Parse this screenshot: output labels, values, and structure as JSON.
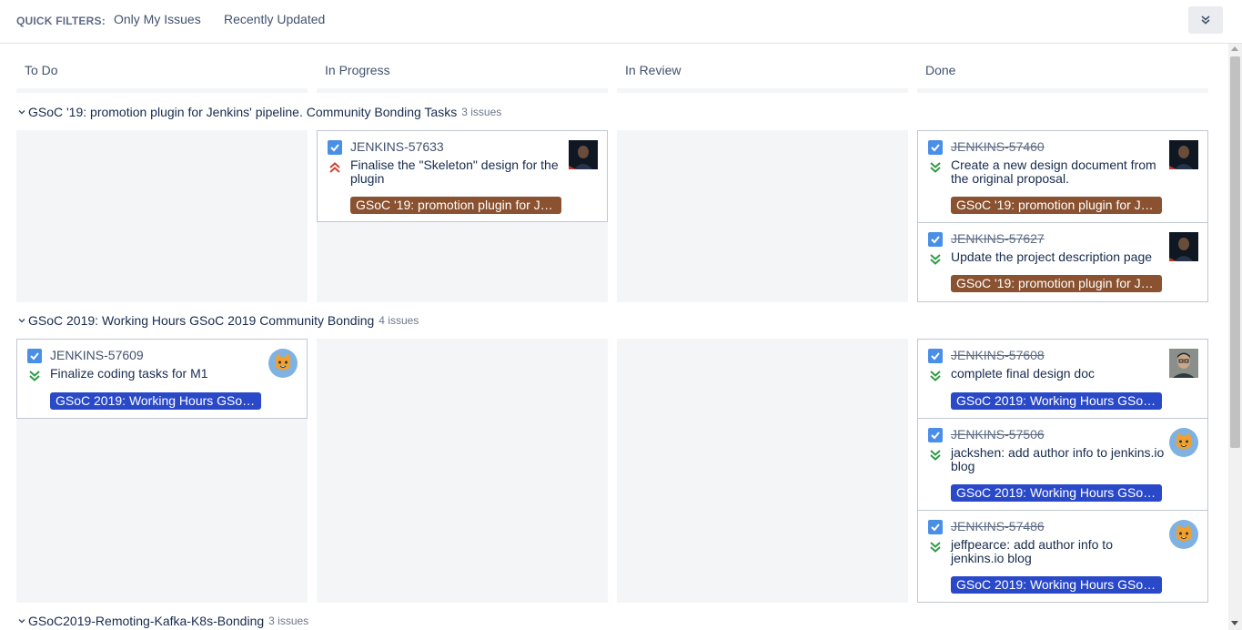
{
  "quick_filters": {
    "label": "QUICK FILTERS:",
    "items": [
      "Only My Issues",
      "Recently Updated"
    ]
  },
  "columns": [
    "To Do",
    "In Progress",
    "In Review",
    "Done"
  ],
  "swimlanes": [
    {
      "title": "GSoC '19: promotion plugin for Jenkins' pipeline. Community Bonding Tasks",
      "count": "3 issues",
      "in_progress": [
        {
          "key": "JENKINS-57633",
          "summary": "Finalise the \"Skeleton\" design for the plugin",
          "epic": "GSoC '19: promotion plugin for Je…",
          "priority": "highest"
        }
      ],
      "done": [
        {
          "key": "JENKINS-57460",
          "summary": "Create a new design document from the original proposal.",
          "epic": "GSoC '19: promotion plugin for Je…",
          "priority": "lowest"
        },
        {
          "key": "JENKINS-57627",
          "summary": "Update the project description page",
          "epic": "GSoC '19: promotion plugin for Je…",
          "priority": "lowest"
        }
      ]
    },
    {
      "title": "GSoC 2019: Working Hours GSoC 2019 Community Bonding",
      "count": "4 issues",
      "todo": [
        {
          "key": "JENKINS-57609",
          "summary": "Finalize coding tasks for M1",
          "epic": "GSoC 2019: Working Hours GSoC…",
          "priority": "lowest"
        }
      ],
      "done": [
        {
          "key": "JENKINS-57608",
          "summary": "complete final design doc",
          "epic": "GSoC 2019: Working Hours GSoC…",
          "priority": "lowest"
        },
        {
          "key": "JENKINS-57506",
          "summary": "jackshen: add author info to jenkins.io blog",
          "epic": "GSoC 2019: Working Hours GSoC…",
          "priority": "lowest"
        },
        {
          "key": "JENKINS-57486",
          "summary": "jeffpearce: add author info to jenkins.io blog",
          "epic": "GSoC 2019: Working Hours GSoC…",
          "priority": "lowest"
        }
      ]
    },
    {
      "title": "GSoC2019-Remoting-Kafka-K8s-Bonding",
      "count": "3 issues"
    }
  ],
  "colors": {
    "epic_brown": "#8a5230",
    "epic_blue": "#2a49c9",
    "checkbox": "#4a8fe7",
    "priority_high": "#d04437",
    "priority_low": "#2e9c48"
  }
}
